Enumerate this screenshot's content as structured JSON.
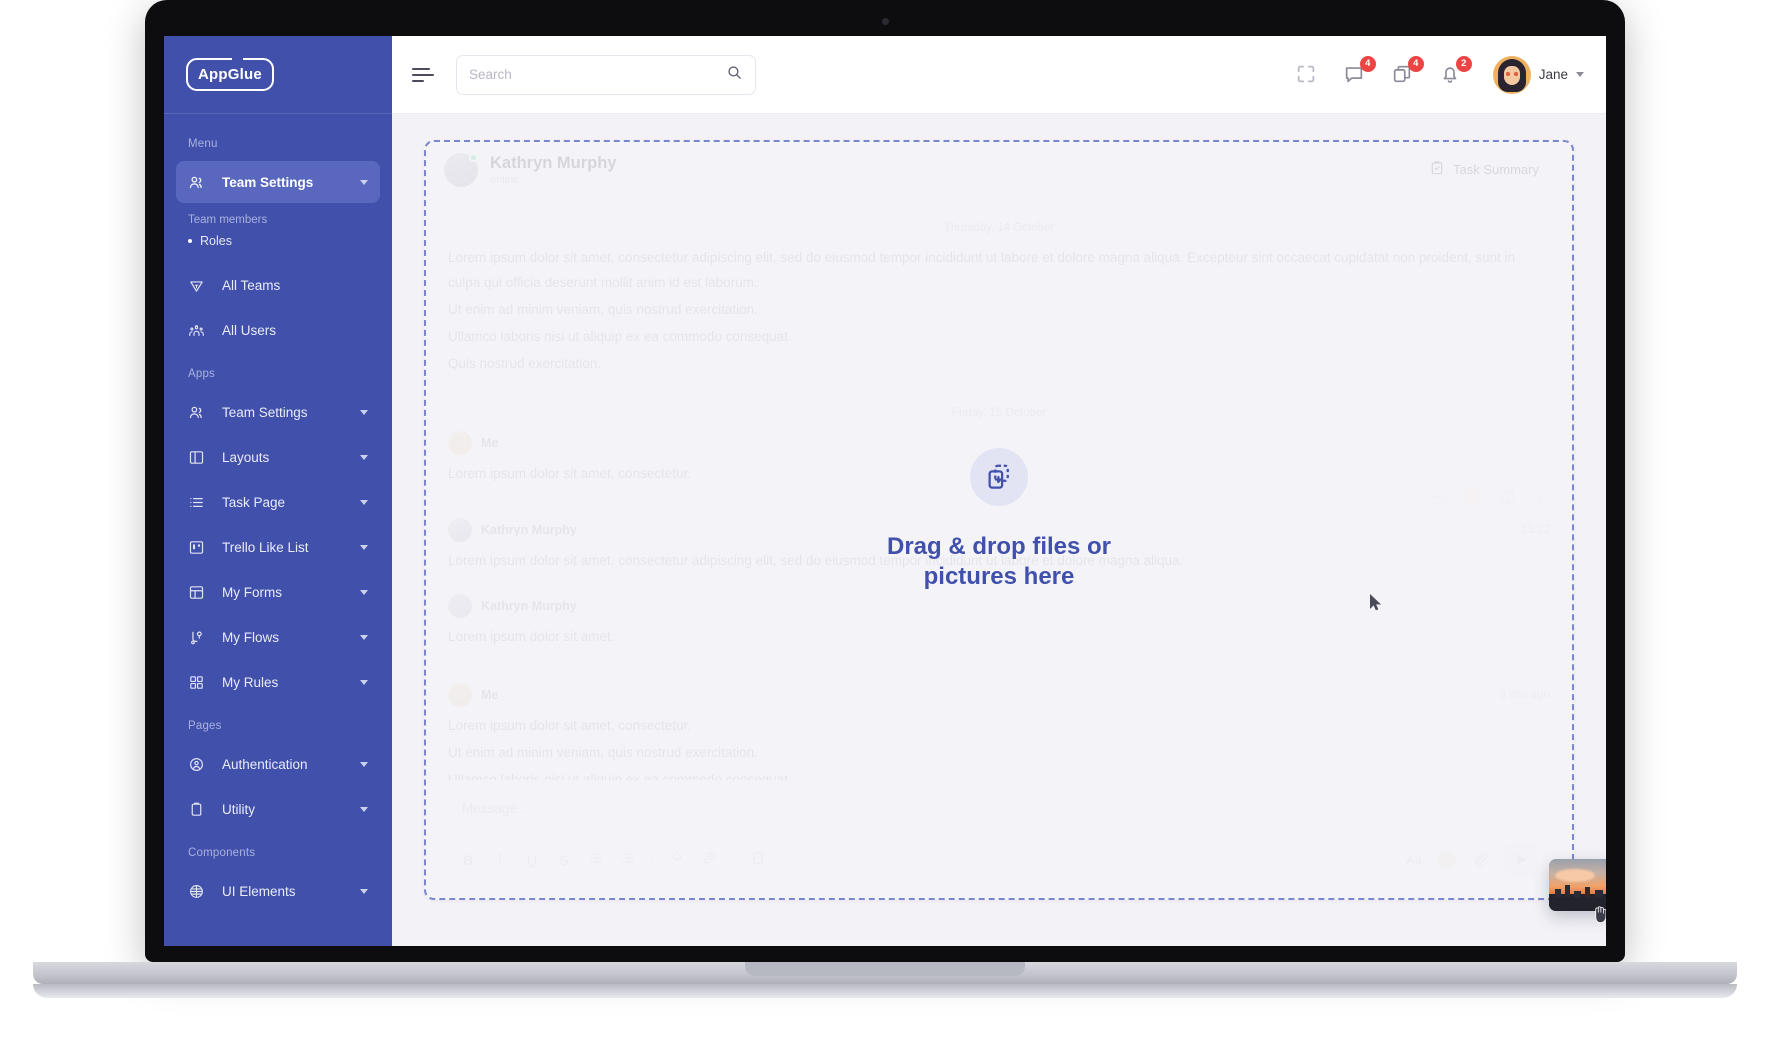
{
  "brand": {
    "logo_text": "AppGlue",
    "accent": "#4150ab",
    "sidebar_bg": "#4150ab"
  },
  "sidebar": {
    "sections": [
      {
        "label": "Menu"
      },
      {
        "label": "Apps"
      },
      {
        "label": "Pages"
      },
      {
        "label": "Components"
      }
    ],
    "menu": {
      "title": "Menu",
      "active_item": {
        "label": "Team Settings",
        "icon": "users-icon",
        "caret": "chevron-down-icon"
      },
      "sub_title": "Team members",
      "sub_item": "Roles",
      "items": [
        {
          "label": "All Teams",
          "icon": "diamond-icon"
        },
        {
          "label": "All Users",
          "icon": "group-icon"
        }
      ]
    },
    "apps": {
      "title": "Apps",
      "items": [
        {
          "label": "Team Settings",
          "icon": "users-icon"
        },
        {
          "label": "Layouts",
          "icon": "layout-icon"
        },
        {
          "label": "Task Page",
          "icon": "list-icon"
        },
        {
          "label": "Trello Like List",
          "icon": "board-icon"
        },
        {
          "label": "My Forms",
          "icon": "form-icon"
        },
        {
          "label": "My Flows",
          "icon": "flow-icon"
        },
        {
          "label": "My Rules",
          "icon": "grid-icon"
        }
      ]
    },
    "pages": {
      "title": "Pages",
      "items": [
        {
          "label": "Authentication",
          "icon": "user-circle-icon"
        },
        {
          "label": "Utility",
          "icon": "clipboard-icon"
        }
      ]
    },
    "components": {
      "title": "Components",
      "items": [
        {
          "label": "UI Elements",
          "icon": "sphere-icon"
        }
      ]
    }
  },
  "topbar": {
    "menu_toggle": "hamburger-icon",
    "search": {
      "placeholder": "Search",
      "value": "",
      "icon": "search-icon"
    },
    "fullscreen_icon": "expand-icon",
    "messages": {
      "icon": "chat-icon",
      "badge": "4"
    },
    "files": {
      "icon": "copy-icon",
      "badge": "4"
    },
    "notifications": {
      "icon": "bell-icon",
      "badge": "2"
    },
    "user": {
      "name": "Jane",
      "avatar": "user-avatar",
      "caret": "chevron-down-icon"
    }
  },
  "chat": {
    "header": {
      "name": "Kathryn Murphy",
      "status": "online",
      "status_color": "#22c55e",
      "task_button": {
        "label": "Task Summary",
        "icon": "clipboard-check-icon"
      }
    },
    "days": [
      {
        "label": "Thursday, 14 October"
      },
      {
        "label": "Friday, 15 October"
      }
    ],
    "messages": [
      {
        "author": "",
        "time": "",
        "lines": [
          "Lorem ipsum dolor sit amet, consectetur adipiscing elit, sed do eiusmod tempor incididunt ut labore et dolore magna aliqua. Excepteur sint occaecat cupidatat non proident, sunt in culpa qui officia deserunt mollit anim id est laborum.",
          "Ut enim ad minim veniam, quis nostrud exercitation.",
          "Ullamco laboris nisi ut aliquip ex ea commodo consequat.",
          "Quis nostrud exercitation."
        ]
      },
      {
        "author": "Me",
        "time": "",
        "lines": [
          "Lorem ipsum dolor sit amet, consectetur."
        ]
      },
      {
        "author": "Kathryn Murphy",
        "time": "15:22",
        "lines": [
          "Lorem ipsum dolor sit amet, consectetur adipiscing elit, sed do eiusmod tempor incididunt ut labore et dolore magna aliqua."
        ]
      },
      {
        "author": "Kathryn Murphy",
        "time": "",
        "lines": [
          "Lorem ipsum dolor sit amet."
        ]
      },
      {
        "author": "Me",
        "time": "3 min ago",
        "lines": [
          "Lorem ipsum dolor sit amet, consectetur.",
          "Ut enim ad minim veniam, quis nostrud exercitation.",
          "Ullamco laboris nisi ut aliquip ex ea commodo consequat."
        ]
      }
    ],
    "message_actions": [
      {
        "icon": "reply-icon"
      },
      {
        "icon": "emoji-icon"
      },
      {
        "icon": "copy-icon"
      },
      {
        "icon": "more-vertical-icon"
      }
    ],
    "composer": {
      "placeholder": "Message...",
      "tools": [
        {
          "icon": "bold-icon",
          "label": "B"
        },
        {
          "icon": "italic-icon",
          "label": "I"
        },
        {
          "icon": "underline-icon",
          "label": "U"
        },
        {
          "icon": "strikethrough-icon",
          "label": "S"
        },
        {
          "icon": "bullet-list-icon",
          "label": ""
        },
        {
          "icon": "numbered-list-icon",
          "label": ""
        },
        {
          "icon": "color-fill-icon",
          "label": ""
        },
        {
          "icon": "link-icon",
          "label": ""
        },
        {
          "icon": "clipboard-icon",
          "label": ""
        }
      ],
      "right_tools": [
        {
          "icon": "text-format-icon",
          "label": "Aa"
        },
        {
          "icon": "emoji-icon",
          "label": ""
        },
        {
          "icon": "attachment-icon",
          "label": ""
        }
      ],
      "send": {
        "icon": "send-icon"
      }
    }
  },
  "dropzone": {
    "icon": "add-files-icon",
    "title_line1": "Drag & drop files or",
    "title_line2": "pictures here",
    "text_color": "#4150ab",
    "border_color": "#7b86cf"
  },
  "drag_item": {
    "name": "city-sunset-thumbnail",
    "cursor": "grabbing-hand-cursor"
  }
}
